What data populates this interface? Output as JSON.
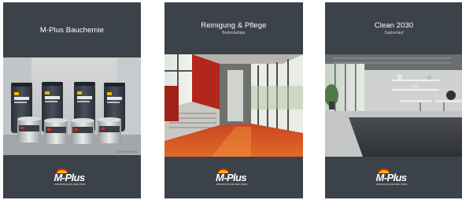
{
  "cards": [
    {
      "title": "M-Plus Bauchemie",
      "subtitle": "",
      "photo": "construction chemical buckets",
      "photo_credit": "Shield 00000000",
      "logo": {
        "text": "M-Plus",
        "tagline": "PRODUKTE FÜR DEN PROFI"
      }
    },
    {
      "title": "Reinigung & Pflege",
      "subtitle": "Bodenbeläge",
      "photo": "interior hallway with red floor and staircase",
      "logo": {
        "text": "M-Plus",
        "tagline": "PRODUKTE FÜR DEN PROFI"
      }
    },
    {
      "title": "Clean 2030",
      "subtitle": "Sauberlauf",
      "photo": "open office with grey floor mat",
      "logo": {
        "text": "M-Plus",
        "tagline": "PRODUKTE FÜR DEN PROFI"
      }
    }
  ],
  "colors": {
    "card_background": "#3b4249",
    "logo_flame_red": "#e2231a",
    "logo_flame_yellow": "#f7b500"
  }
}
